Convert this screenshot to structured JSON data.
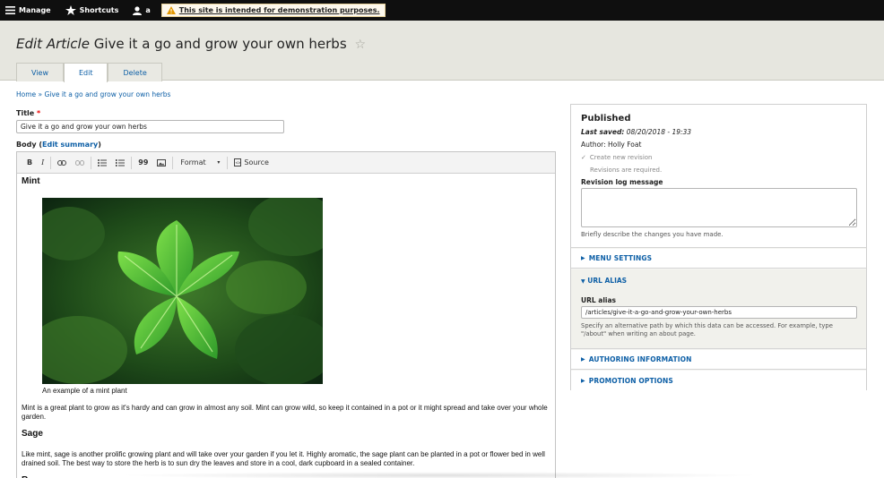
{
  "toolbar": {
    "manage": "Manage",
    "shortcuts": "Shortcuts",
    "user": "a",
    "demo_notice": "This site is intended for demonstration purposes."
  },
  "header": {
    "title_prefix": "Edit Article",
    "title_name": "Give it a go and grow your own herbs",
    "tabs": [
      {
        "label": "View",
        "active": false
      },
      {
        "label": "Edit",
        "active": true
      },
      {
        "label": "Delete",
        "active": false
      }
    ]
  },
  "breadcrumb": "Home » Give it a go and grow your own herbs",
  "form": {
    "title_label": "Title",
    "required_mark": "*",
    "title_value": "Give it a go and grow your own herbs",
    "body_label": "Body",
    "edit_summary": "Edit summary",
    "editor_toolbar": {
      "bold": "B",
      "italic": "I",
      "blockquote": "99",
      "format": "Format",
      "source": "Source"
    },
    "content": {
      "heading_mint": "Mint",
      "mint_caption": "An example of a mint plant",
      "mint_para": "Mint is a great plant to grow as it's hardy and can grow in almost any soil. Mint can grow wild, so keep it contained in a pot or it might spread and take over your whole garden.",
      "heading_sage": "Sage",
      "sage_para": "Like mint, sage is another prolific growing plant and will take over your garden if you let it. Highly aromatic, the sage plant can be planted in a pot or flower bed in well drained soil. The best way to store the herb is to sun dry the leaves and store in a cool, dark cupboard in a sealed container.",
      "heading_next": "R"
    }
  },
  "sidebar": {
    "status": "Published",
    "last_saved_label": "Last saved:",
    "last_saved_value": "08/20/2018 - 19:33",
    "author": "Author: Holly Foat",
    "create_revision": "Create new revision",
    "revisions_required": "Revisions are required.",
    "log_label": "Revision log message",
    "log_help": "Briefly describe the changes you have made.",
    "menu_settings": "MENU SETTINGS",
    "url_alias_head": "URL ALIAS",
    "url_alias_label": "URL alias",
    "url_alias_value": "/articles/give-it-a-go-and-grow-your-own-herbs",
    "url_alias_help": "Specify an alternative path by which this data can be accessed. For example, type \"/about\" when writing an about page.",
    "authoring_info": "AUTHORING INFORMATION",
    "promotion_options": "PROMOTION OPTIONS"
  },
  "colors": {
    "link": "#0d5fa6",
    "toolbar_bg": "#0f0f0f",
    "header_bg": "#e6e6df",
    "required": "#e00000"
  }
}
